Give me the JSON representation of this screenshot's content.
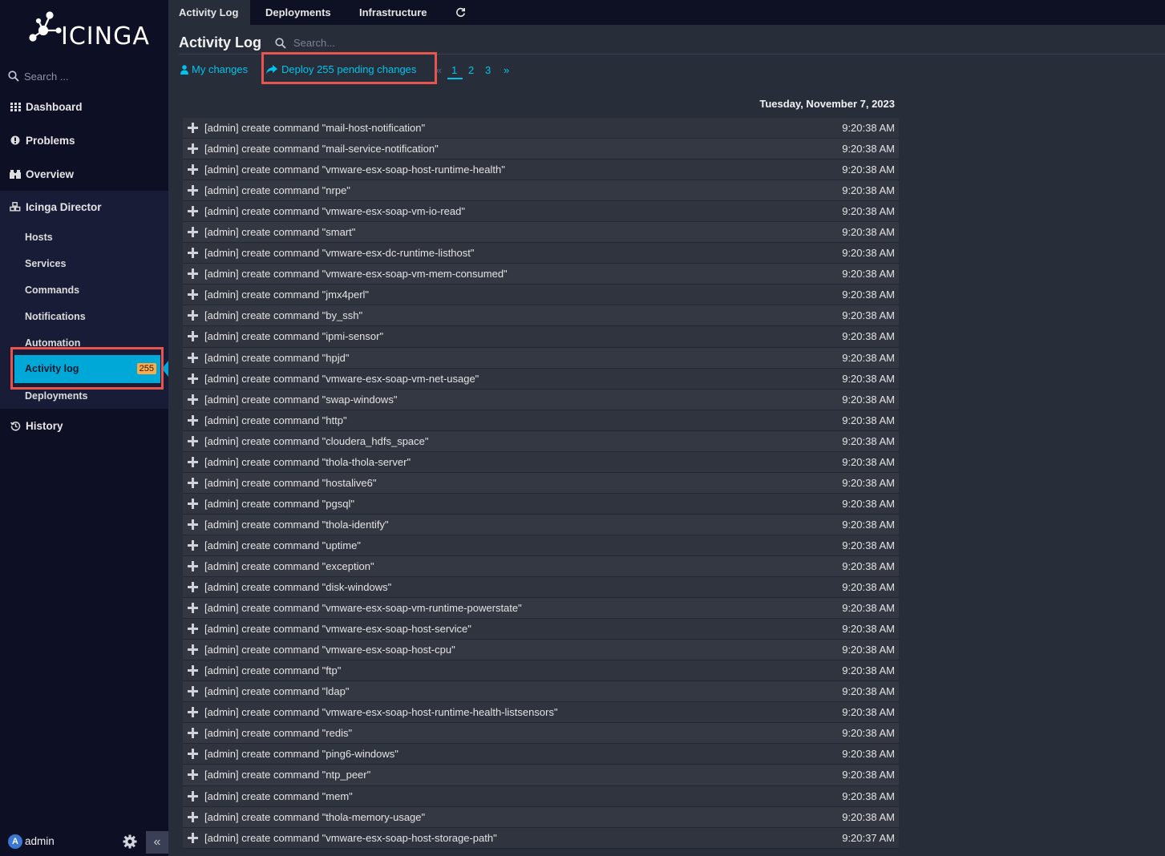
{
  "sidebar": {
    "logo_text": "icinga",
    "search_placeholder": "Search ...",
    "nav": [
      {
        "label": "Dashboard",
        "icon": "grid-icon"
      },
      {
        "label": "Problems",
        "icon": "alert-circle-icon"
      },
      {
        "label": "Overview",
        "icon": "binoculars-icon"
      },
      {
        "label": "Icinga Director",
        "icon": "cubes-icon"
      }
    ],
    "director_items": [
      "Hosts",
      "Services",
      "Commands",
      "Notifications",
      "Automation",
      "Activity log",
      "Deployments"
    ],
    "activity_badge": "255",
    "history_label": "History",
    "user": {
      "initial": "A",
      "name": "admin"
    }
  },
  "tabs": [
    "Activity Log",
    "Deployments",
    "Infrastructure"
  ],
  "content": {
    "title": "Activity Log",
    "search_placeholder": "Search...",
    "my_changes": "My changes",
    "deploy_label": "Deploy 255 pending changes",
    "pagination": {
      "prev": "«",
      "pages": [
        "1",
        "2",
        "3"
      ],
      "next": "»",
      "current": "1"
    },
    "date_heading": "Tuesday, November 7, 2023"
  },
  "log_rows": [
    {
      "text": "[admin] create command \"mail-host-notification\"",
      "time": "9:20:38 AM"
    },
    {
      "text": "[admin] create command \"mail-service-notification\"",
      "time": "9:20:38 AM"
    },
    {
      "text": "[admin] create command \"vmware-esx-soap-host-runtime-health\"",
      "time": "9:20:38 AM"
    },
    {
      "text": "[admin] create command \"nrpe\"",
      "time": "9:20:38 AM"
    },
    {
      "text": "[admin] create command \"vmware-esx-soap-vm-io-read\"",
      "time": "9:20:38 AM"
    },
    {
      "text": "[admin] create command \"smart\"",
      "time": "9:20:38 AM"
    },
    {
      "text": "[admin] create command \"vmware-esx-dc-runtime-listhost\"",
      "time": "9:20:38 AM"
    },
    {
      "text": "[admin] create command \"vmware-esx-soap-vm-mem-consumed\"",
      "time": "9:20:38 AM"
    },
    {
      "text": "[admin] create command \"jmx4perl\"",
      "time": "9:20:38 AM"
    },
    {
      "text": "[admin] create command \"by_ssh\"",
      "time": "9:20:38 AM"
    },
    {
      "text": "[admin] create command \"ipmi-sensor\"",
      "time": "9:20:38 AM"
    },
    {
      "text": "[admin] create command \"hpjd\"",
      "time": "9:20:38 AM"
    },
    {
      "text": "[admin] create command \"vmware-esx-soap-vm-net-usage\"",
      "time": "9:20:38 AM"
    },
    {
      "text": "[admin] create command \"swap-windows\"",
      "time": "9:20:38 AM"
    },
    {
      "text": "[admin] create command \"http\"",
      "time": "9:20:38 AM"
    },
    {
      "text": "[admin] create command \"cloudera_hdfs_space\"",
      "time": "9:20:38 AM"
    },
    {
      "text": "[admin] create command \"thola-thola-server\"",
      "time": "9:20:38 AM"
    },
    {
      "text": "[admin] create command \"hostalive6\"",
      "time": "9:20:38 AM"
    },
    {
      "text": "[admin] create command \"pgsql\"",
      "time": "9:20:38 AM"
    },
    {
      "text": "[admin] create command \"thola-identify\"",
      "time": "9:20:38 AM"
    },
    {
      "text": "[admin] create command \"uptime\"",
      "time": "9:20:38 AM"
    },
    {
      "text": "[admin] create command \"exception\"",
      "time": "9:20:38 AM"
    },
    {
      "text": "[admin] create command \"disk-windows\"",
      "time": "9:20:38 AM"
    },
    {
      "text": "[admin] create command \"vmware-esx-soap-vm-runtime-powerstate\"",
      "time": "9:20:38 AM"
    },
    {
      "text": "[admin] create command \"vmware-esx-soap-host-service\"",
      "time": "9:20:38 AM"
    },
    {
      "text": "[admin] create command \"vmware-esx-soap-host-cpu\"",
      "time": "9:20:38 AM"
    },
    {
      "text": "[admin] create command \"ftp\"",
      "time": "9:20:38 AM"
    },
    {
      "text": "[admin] create command \"ldap\"",
      "time": "9:20:38 AM"
    },
    {
      "text": "[admin] create command \"vmware-esx-soap-host-runtime-health-listsensors\"",
      "time": "9:20:38 AM"
    },
    {
      "text": "[admin] create command \"redis\"",
      "time": "9:20:38 AM"
    },
    {
      "text": "[admin] create command \"ping6-windows\"",
      "time": "9:20:38 AM"
    },
    {
      "text": "[admin] create command \"ntp_peer\"",
      "time": "9:20:38 AM"
    },
    {
      "text": "[admin] create command \"mem\"",
      "time": "9:20:38 AM"
    },
    {
      "text": "[admin] create command \"thola-memory-usage\"",
      "time": "9:20:38 AM"
    },
    {
      "text": "[admin] create command \"vmware-esx-soap-host-storage-path\"",
      "time": "9:20:37 AM"
    }
  ],
  "colors": {
    "accent": "#00c3ed",
    "highlight": "#e8554e",
    "badge": "#ffaa44",
    "sidebar": "#0d0f25"
  }
}
